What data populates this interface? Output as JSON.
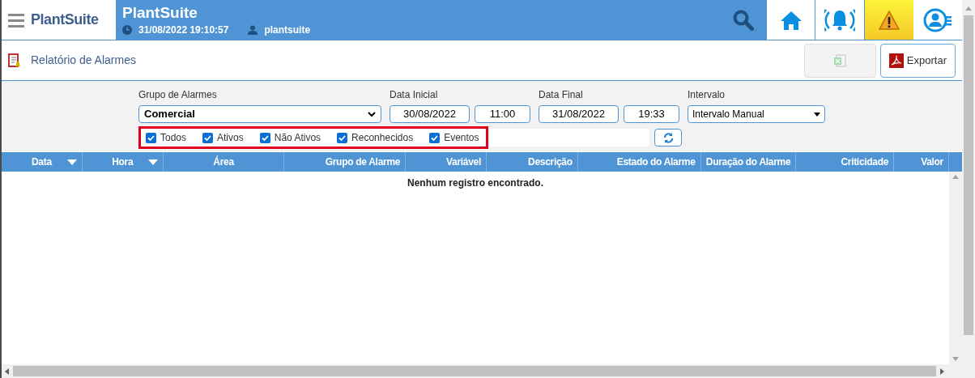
{
  "header": {
    "brand": "PlantSuite",
    "title": "PlantSuite",
    "datetime": "31/08/2022 19:10:57",
    "user": "plantsuite",
    "alert_active": true
  },
  "page": {
    "title": "Relatório de Alarmes",
    "export_excel": {
      "disabled": true
    },
    "export_pdf": {
      "label": "Exportar"
    }
  },
  "filters": {
    "group": {
      "label": "Grupo de Alarmes",
      "value": "Comercial"
    },
    "start": {
      "label": "Data Inicial",
      "date": "30/08/2022",
      "time": "11:00"
    },
    "end": {
      "label": "Data Final",
      "date": "31/08/2022",
      "time": "19:33"
    },
    "interval": {
      "label": "Intervalo",
      "value": "Intervalo Manual"
    },
    "states": [
      {
        "label": "Todos",
        "checked": true
      },
      {
        "label": "Ativos",
        "checked": true
      },
      {
        "label": "Não Ativos",
        "checked": true
      },
      {
        "label": "Reconhecidos",
        "checked": true
      },
      {
        "label": "Eventos",
        "checked": true
      }
    ]
  },
  "table": {
    "columns": [
      {
        "label": "Data",
        "sortable": true
      },
      {
        "label": "Hora",
        "sortable": true
      },
      {
        "label": "Área",
        "sortable": false
      },
      {
        "label": "Grupo de Alarme",
        "sortable": false
      },
      {
        "label": "Variável",
        "sortable": false
      },
      {
        "label": "Descrição",
        "sortable": false
      },
      {
        "label": "Estado do Alarme",
        "sortable": false
      },
      {
        "label": "Duração do Alarme",
        "sortable": false
      },
      {
        "label": "Criticidade",
        "sortable": false
      },
      {
        "label": "Valor",
        "sortable": false
      }
    ],
    "empty_message": "Nenhum registro encontrado."
  }
}
